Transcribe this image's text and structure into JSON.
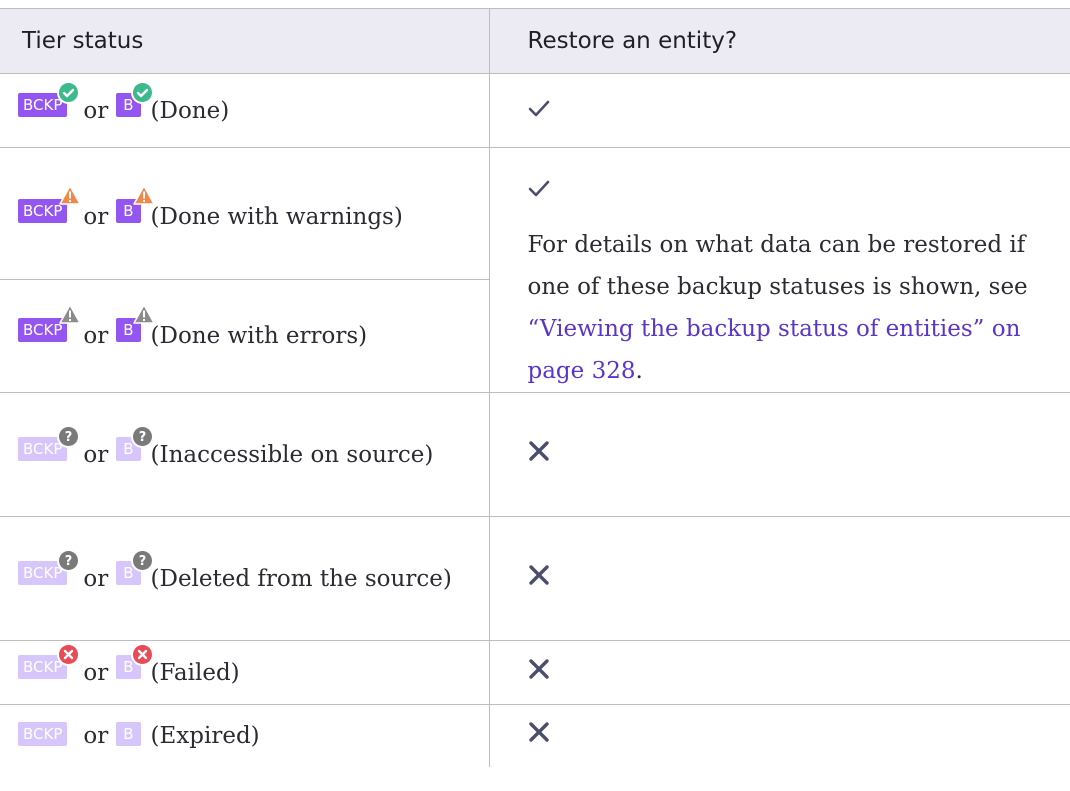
{
  "header": {
    "col1": "Tier status",
    "col2": "Restore an entity?"
  },
  "badges": {
    "full": "BCKP",
    "short": "B"
  },
  "connector": "or",
  "rows": [
    {
      "status": "(Done)",
      "overlay": "success-check",
      "restorable": "check"
    },
    {
      "status": "(Done with warnings)",
      "overlay": "warning-triangle",
      "restorable": "check"
    },
    {
      "status": "(Done with errors)",
      "overlay": "error-triangle",
      "restorable": "check"
    },
    {
      "status": "(Inaccessible on source)",
      "overlay": "question",
      "restorable": "cross"
    },
    {
      "status": "(Deleted from the source)",
      "overlay": "question",
      "restorable": "cross"
    },
    {
      "status": "(Failed)",
      "overlay": "failed-x",
      "restorable": "cross"
    },
    {
      "status": "(Expired)",
      "overlay": "none",
      "restorable": "cross"
    }
  ],
  "note": {
    "text": "For details on what data can be restored if one of these backup statuses is shown, see ",
    "link": "“Viewing the backup status of entities” on page 328",
    "trail": "."
  },
  "colors": {
    "badge": "#9356f0",
    "badge_faded": "#d7c6fb",
    "success": "#3cba8c",
    "warning": "#f0884a",
    "error_gray": "#8b8b8b",
    "failed": "#e94b56",
    "mark": "#4a4e6a",
    "link": "#5b35c9"
  }
}
